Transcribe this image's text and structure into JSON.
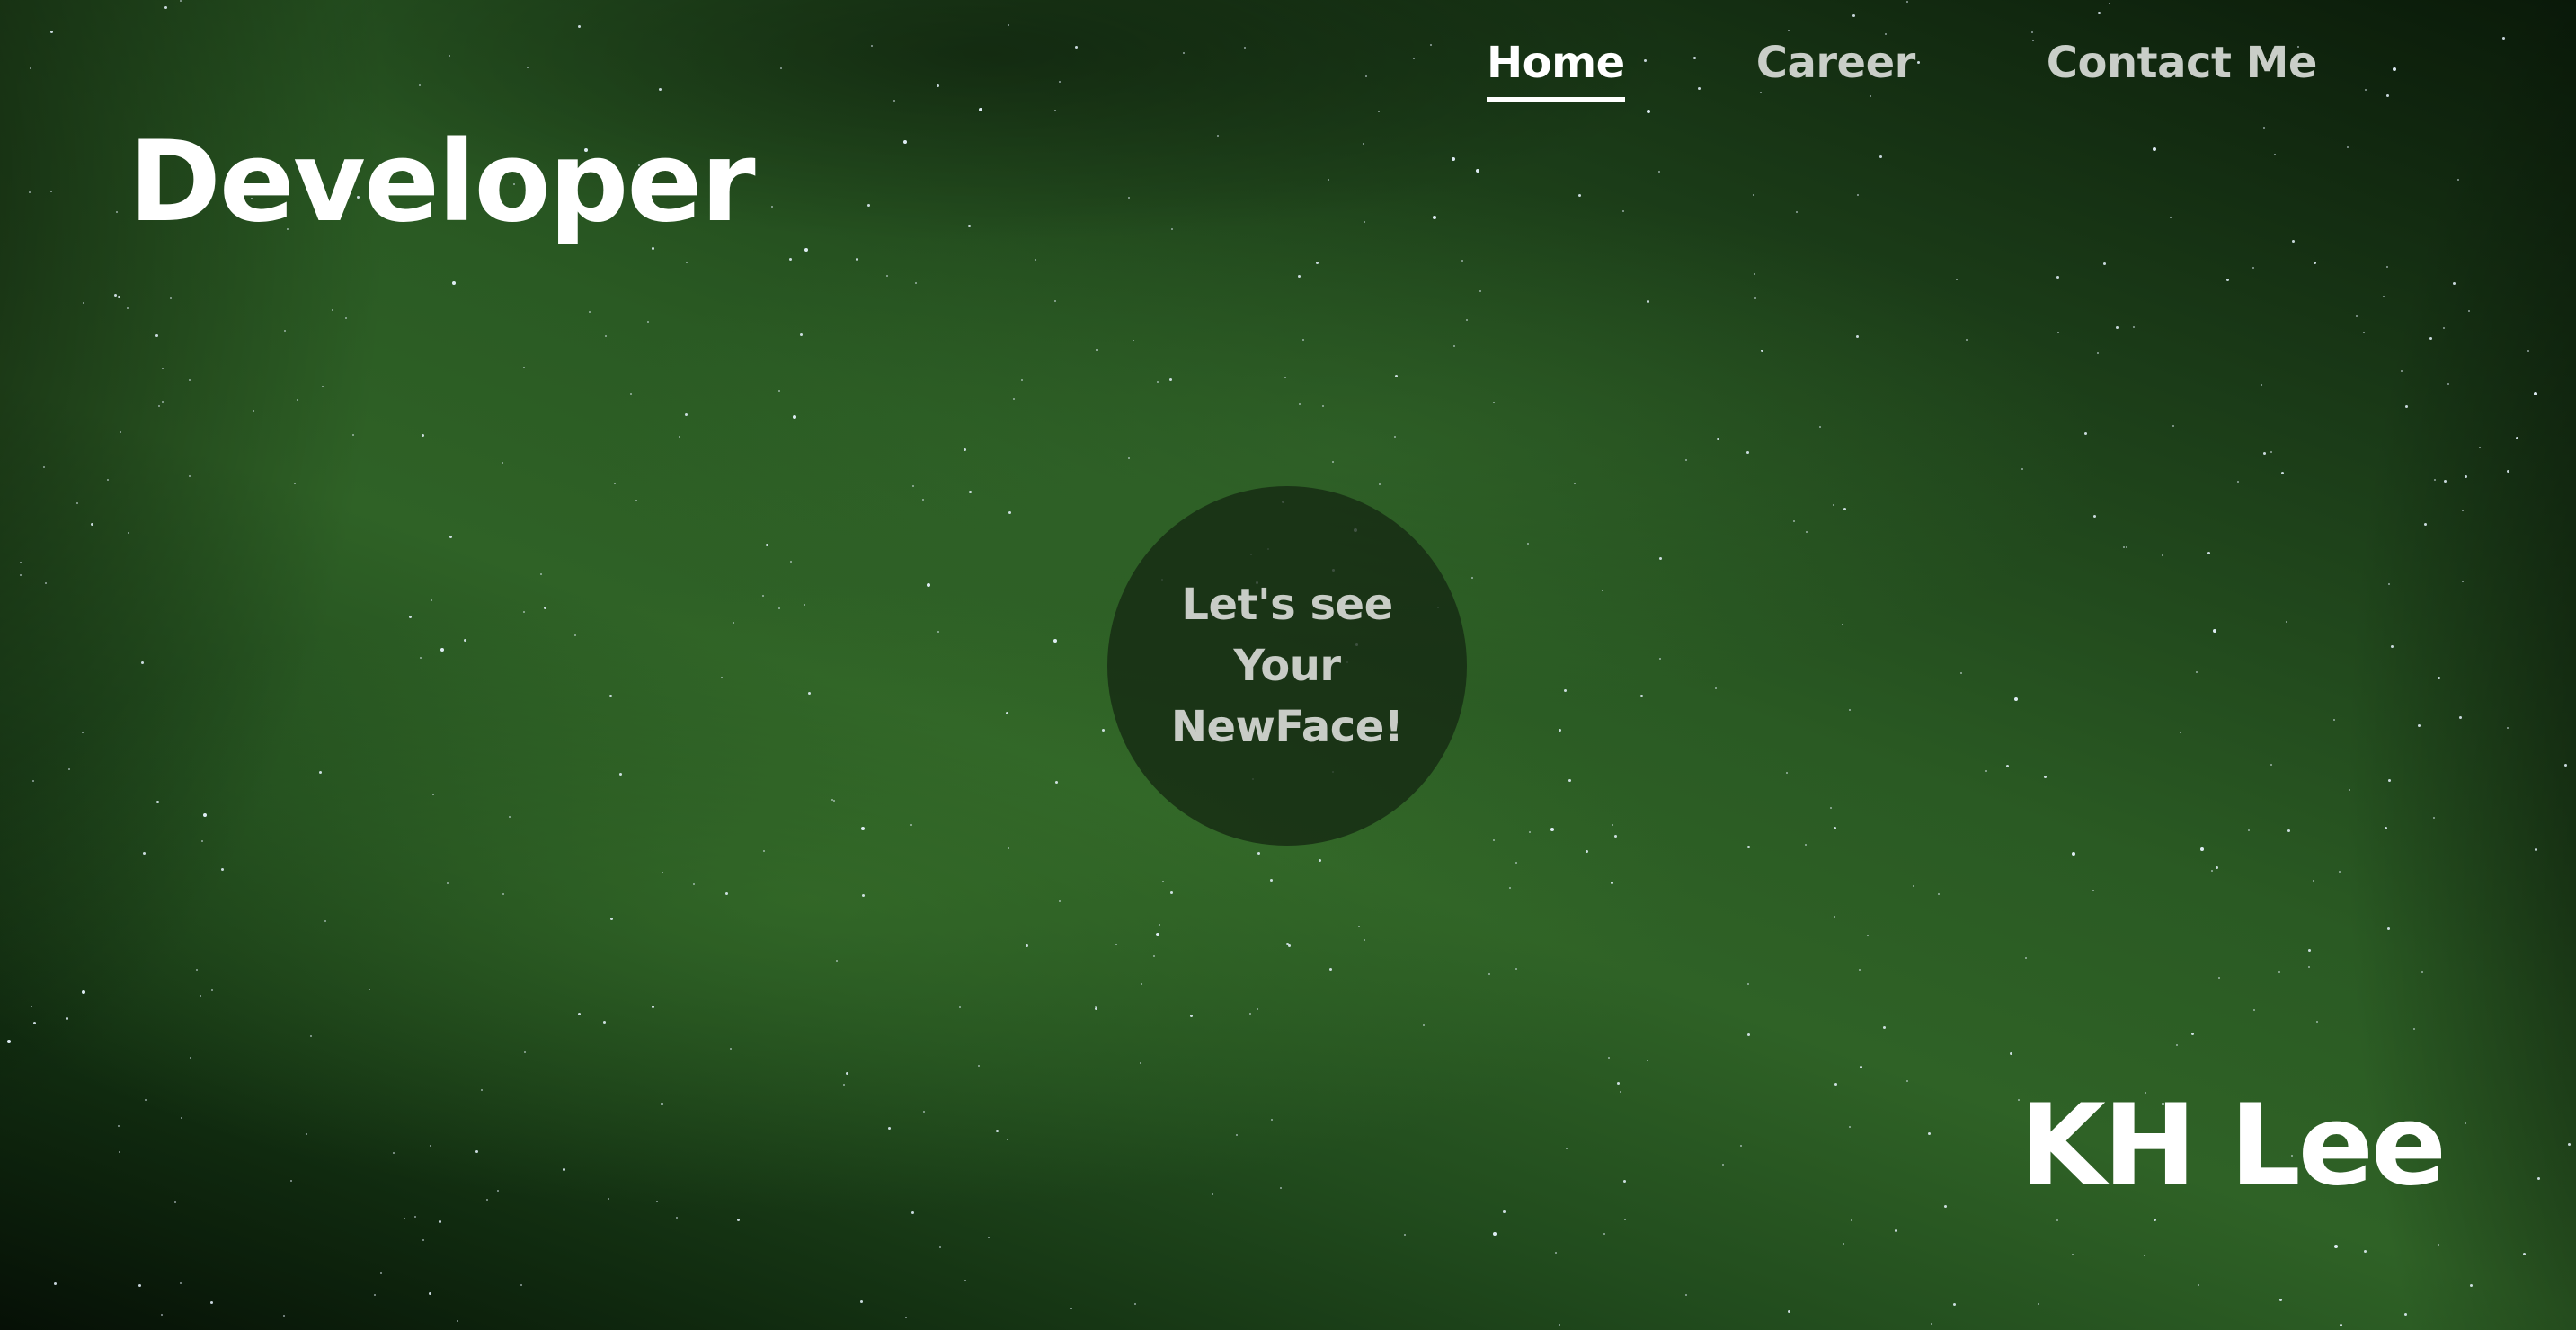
{
  "nav": {
    "items": [
      {
        "label": "Home",
        "active": true
      },
      {
        "label": "Career",
        "active": false
      },
      {
        "label": "Contact Me",
        "active": false
      }
    ]
  },
  "hero": {
    "brand": "Developer",
    "cta_line1": "Let's see",
    "cta_line2": "Your",
    "cta_line3": "NewFace!",
    "name": "KH Lee"
  },
  "colors": {
    "background": "#2a5a23",
    "text_primary": "#ffffff",
    "text_muted": "#c9cec8",
    "circle": "#142812"
  }
}
